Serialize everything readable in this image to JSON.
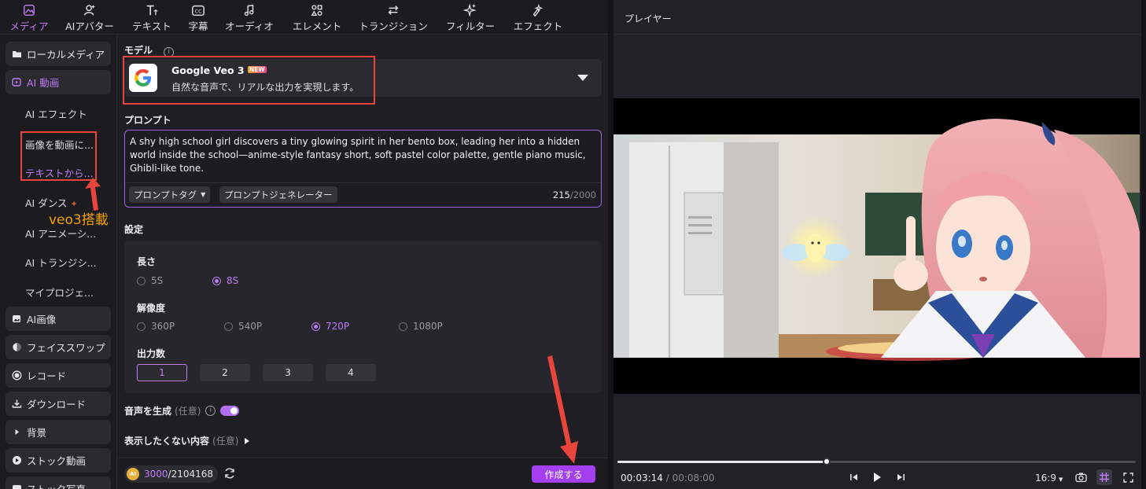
{
  "toolbar": {
    "tabs": [
      {
        "label": "メディア",
        "icon": "media-icon",
        "active": true
      },
      {
        "label": "AIアバター",
        "icon": "avatar-icon"
      },
      {
        "label": "テキスト",
        "icon": "text-icon"
      },
      {
        "label": "字幕",
        "icon": "caption-icon"
      },
      {
        "label": "オーディオ",
        "icon": "music-note-icon"
      },
      {
        "label": "エレメント",
        "icon": "element-icon"
      },
      {
        "label": "トランジション",
        "icon": "transition-icon"
      },
      {
        "label": "フィルター",
        "icon": "sparkle-icon"
      },
      {
        "label": "エフェクト",
        "icon": "effect-icon"
      }
    ]
  },
  "sidebar": {
    "items": [
      {
        "label": "ローカルメディア",
        "icon": "folder-icon"
      },
      {
        "label": "AI 動画",
        "icon": "ai-video-icon",
        "active": true
      },
      {
        "label": "AI画像",
        "icon": "ai-image-icon"
      },
      {
        "label": "フェイススワップ",
        "icon": "face-swap-icon"
      },
      {
        "label": "レコード",
        "icon": "record-icon"
      },
      {
        "label": "ダウンロード",
        "icon": "download-icon"
      },
      {
        "label": "背景",
        "icon": "caret-right-icon"
      },
      {
        "label": "ストック動画",
        "icon": "play-circle-icon"
      },
      {
        "label": "ストック写真",
        "icon": "photo-icon"
      }
    ],
    "sub_items": [
      {
        "label": "AI エフェクト"
      },
      {
        "label": "画像を動画に..."
      },
      {
        "label": "テキストから...",
        "active": true
      },
      {
        "label": "AI ダンス"
      },
      {
        "label": "AI アニメーシ..."
      },
      {
        "label": "AI トランジシ..."
      },
      {
        "label": "マイプロジェ..."
      }
    ]
  },
  "annotation": {
    "label": "veo3搭載",
    "color": "#f2a100",
    "box_color": "#e8453c"
  },
  "model": {
    "section_label": "モデル",
    "name": "Google Veo 3",
    "badge": "NEW",
    "description": "自然な音声で、リアルな出力を実現します。"
  },
  "prompt": {
    "section_label": "プロンプト",
    "text": "A shy high school girl discovers a tiny glowing spirit in her bento box, leading her into a hidden world inside the school—anime-style fantasy short, soft pastel color palette, gentle piano music, Ghibli-like tone.",
    "tag_button": "プロンプトタグ",
    "generator_button": "プロンプトジェネレーター",
    "count": "215",
    "max": "/2000"
  },
  "settings": {
    "section_label": "設定",
    "duration": {
      "label": "長さ",
      "options": [
        "5S",
        "8S"
      ],
      "selected": "8S"
    },
    "resolution": {
      "label": "解像度",
      "options": [
        "360P",
        "540P",
        "720P",
        "1080P"
      ],
      "selected": "720P"
    },
    "outputs": {
      "label": "出力数",
      "options": [
        "1",
        "2",
        "3",
        "4"
      ],
      "selected": "1"
    }
  },
  "audio": {
    "label": "音声を生成",
    "optional": "(任意)",
    "enabled": true
  },
  "negative": {
    "label": "表示したくない内容",
    "optional": "(任意)"
  },
  "credits": {
    "used": "3000",
    "total": "/2104168"
  },
  "create_button": "作成する",
  "player": {
    "title": "プレイヤー",
    "current_time": "00:03:14",
    "separator": "/",
    "total_time": "00:08:00",
    "progress": 0.404,
    "aspect": "16:9"
  },
  "colors": {
    "accent": "#c07cf6",
    "button": "#a43ff0",
    "annotation_red": "#e8453c"
  }
}
